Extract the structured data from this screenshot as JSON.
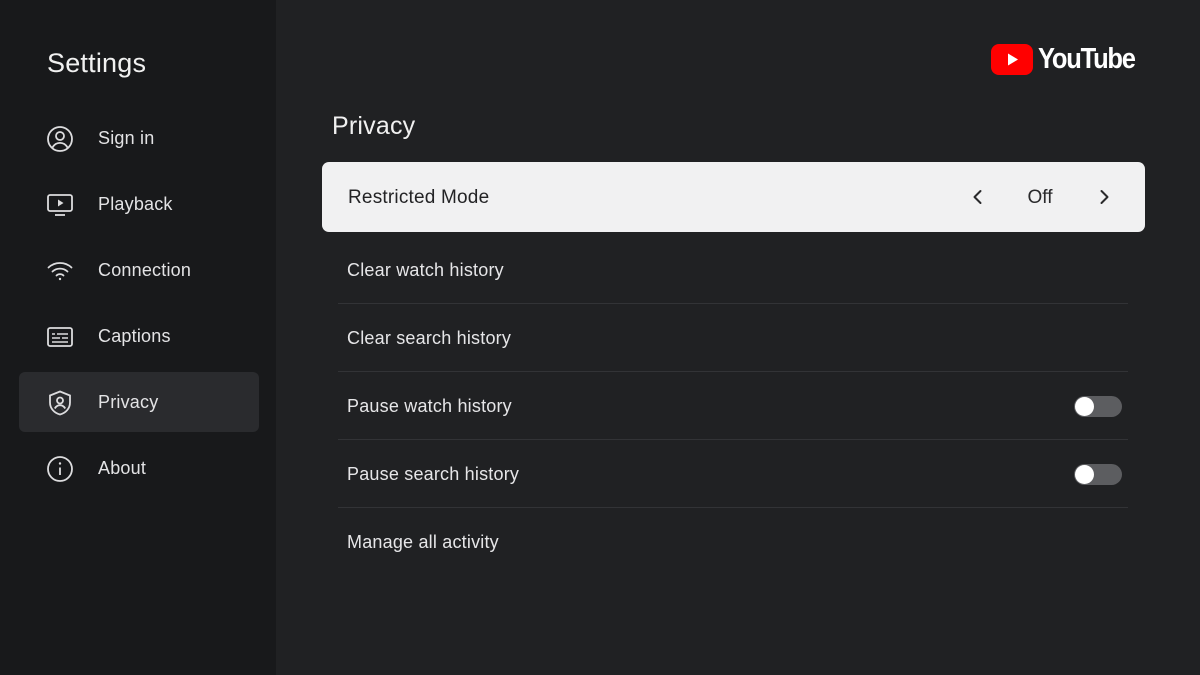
{
  "sidebar": {
    "title": "Settings",
    "items": [
      {
        "label": "Sign in",
        "icon": "account-circle-icon",
        "active": false
      },
      {
        "label": "Playback",
        "icon": "tv-play-icon",
        "active": false
      },
      {
        "label": "Connection",
        "icon": "wifi-icon",
        "active": false
      },
      {
        "label": "Captions",
        "icon": "captions-icon",
        "active": false
      },
      {
        "label": "Privacy",
        "icon": "shield-user-icon",
        "active": true
      },
      {
        "label": "About",
        "icon": "info-icon",
        "active": false
      }
    ]
  },
  "logo": {
    "text": "YouTube",
    "icon": "youtube-play-icon",
    "brand_color": "#ff0000"
  },
  "main": {
    "title": "Privacy",
    "restricted_mode": {
      "label": "Restricted Mode",
      "value": "Off",
      "icons": [
        "chevron-left-icon",
        "chevron-right-icon"
      ]
    },
    "rows": [
      {
        "label": "Clear watch history",
        "type": "action"
      },
      {
        "label": "Clear search history",
        "type": "action"
      },
      {
        "label": "Pause watch history",
        "type": "toggle",
        "on": false
      },
      {
        "label": "Pause search history",
        "type": "toggle",
        "on": false
      },
      {
        "label": "Manage all activity",
        "type": "action"
      }
    ]
  },
  "colors": {
    "background": "#202123",
    "sidebar": "#18191b",
    "focus_row": "#f1f1f2",
    "toggle_off": "#5c5d60"
  }
}
